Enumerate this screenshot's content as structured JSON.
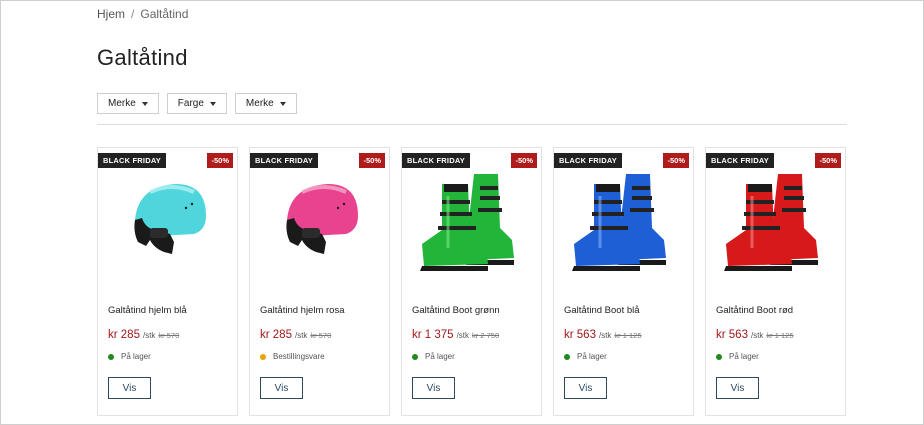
{
  "breadcrumb": {
    "home": "Hjem",
    "separator": "/",
    "current": "Galtåtind"
  },
  "page_title": "Galtåtind",
  "filters": [
    {
      "label": "Merke"
    },
    {
      "label": "Farge"
    },
    {
      "label": "Merke"
    }
  ],
  "products": [
    {
      "badge": "BLACK FRIDAY",
      "discount": "-50%",
      "name": "Galtåtind hjelm blå",
      "price": "kr 285",
      "unit": "/stk",
      "old_price": "kr 570",
      "stock": "På lager",
      "stock_color": "#1f8a1f",
      "button": "Vis",
      "image_icon": "helmet-icon",
      "color": "#4fd6dc"
    },
    {
      "badge": "BLACK FRIDAY",
      "discount": "-50%",
      "name": "Galtåtind hjelm rosa",
      "price": "kr 285",
      "unit": "/stk",
      "old_price": "kr 570",
      "stock": "Bestillingsvare",
      "stock_color": "#e8a400",
      "button": "Vis",
      "image_icon": "helmet-icon",
      "color": "#e9428f"
    },
    {
      "badge": "BLACK FRIDAY",
      "discount": "-50%",
      "name": "Galtåtind Boot grønn",
      "price": "kr 1 375",
      "unit": "/stk",
      "old_price": "kr 2 750",
      "stock": "På lager",
      "stock_color": "#1f8a1f",
      "button": "Vis",
      "image_icon": "ski-boot-icon",
      "color": "#23b43a"
    },
    {
      "badge": "BLACK FRIDAY",
      "discount": "-50%",
      "name": "Galtåtind Boot blå",
      "price": "kr 563",
      "unit": "/stk",
      "old_price": "kr 1 125",
      "stock": "På lager",
      "stock_color": "#1f8a1f",
      "button": "Vis",
      "image_icon": "ski-boot-icon",
      "color": "#1f5fd6"
    },
    {
      "badge": "BLACK FRIDAY",
      "discount": "-50%",
      "name": "Galtåtind Boot rød",
      "price": "kr 563",
      "unit": "/stk",
      "old_price": "kr 1 125",
      "stock": "På lager",
      "stock_color": "#1f8a1f",
      "button": "Vis",
      "image_icon": "ski-boot-icon",
      "color": "#d61a1a"
    }
  ]
}
